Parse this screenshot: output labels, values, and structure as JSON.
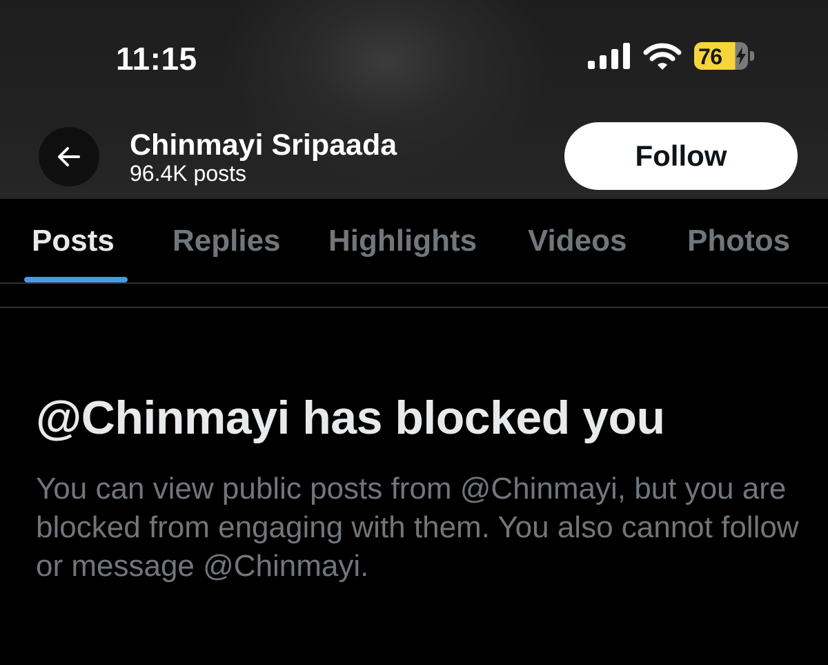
{
  "status_bar": {
    "time": "11:15",
    "battery_level": "76",
    "icons": [
      "signal-bars-icon",
      "wifi-icon",
      "battery-charging-icon"
    ]
  },
  "header": {
    "back_icon": "arrow-left-icon",
    "name": "Chinmayi Sripaada",
    "posts_count": "96.4K posts",
    "follow_label": "Follow"
  },
  "tabs": [
    {
      "label": "Posts",
      "active": true
    },
    {
      "label": "Replies",
      "active": false
    },
    {
      "label": "Highlights",
      "active": false
    },
    {
      "label": "Videos",
      "active": false
    },
    {
      "label": "Photos",
      "active": false
    }
  ],
  "blocked": {
    "title": "@Chinmayi has blocked you",
    "message": "You can view public posts from @Chinmayi, but you are blocked from engaging with them. You also cannot follow or message @Chinmayi."
  },
  "colors": {
    "background": "#000000",
    "accent": "#4a99e9",
    "battery_fill": "#f5d53c",
    "muted_text": "#71767b",
    "primary_text": "#e7e9ea"
  }
}
